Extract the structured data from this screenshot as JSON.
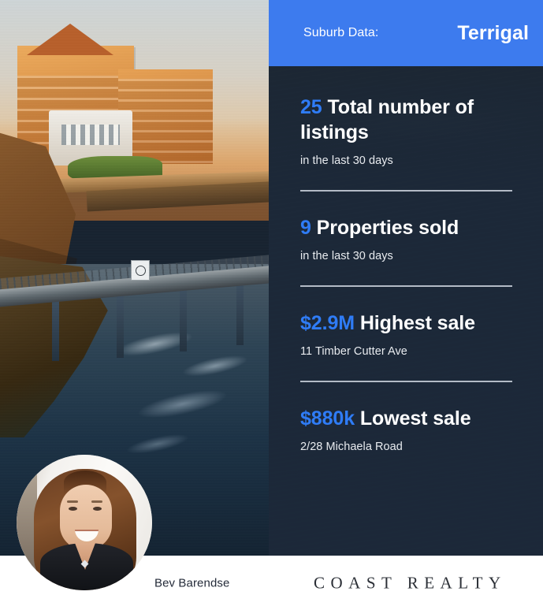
{
  "header": {
    "label": "Suburb Data:",
    "suburb": "Terrigal",
    "accent_color": "#3d7bee"
  },
  "panel": {
    "background_color": "#1e2b3d",
    "accent_color": "#2f7cf6",
    "divider_color": "#b3bbc6"
  },
  "stats": [
    {
      "value": "25",
      "label": "Total number of listings",
      "sub": "in the last 30 days"
    },
    {
      "value": "9",
      "label": "Properties sold",
      "sub": "in the last 30 days"
    },
    {
      "value": "$2.9M",
      "label": "Highest sale",
      "sub": "11 Timber Cutter Ave"
    },
    {
      "value": "$880k",
      "label": "Lowest sale",
      "sub": "2/28 Michaela Road"
    }
  ],
  "footer": {
    "agent_name": "Bev Barendse",
    "brand": "COAST REALTY",
    "text_color": "#242b39"
  },
  "photo": {
    "alt": "Terrigal coastline at sunset with hotel, Norfolk pines, rock pool boardwalk"
  },
  "avatar": {
    "alt": "Bev Barendse headshot"
  }
}
